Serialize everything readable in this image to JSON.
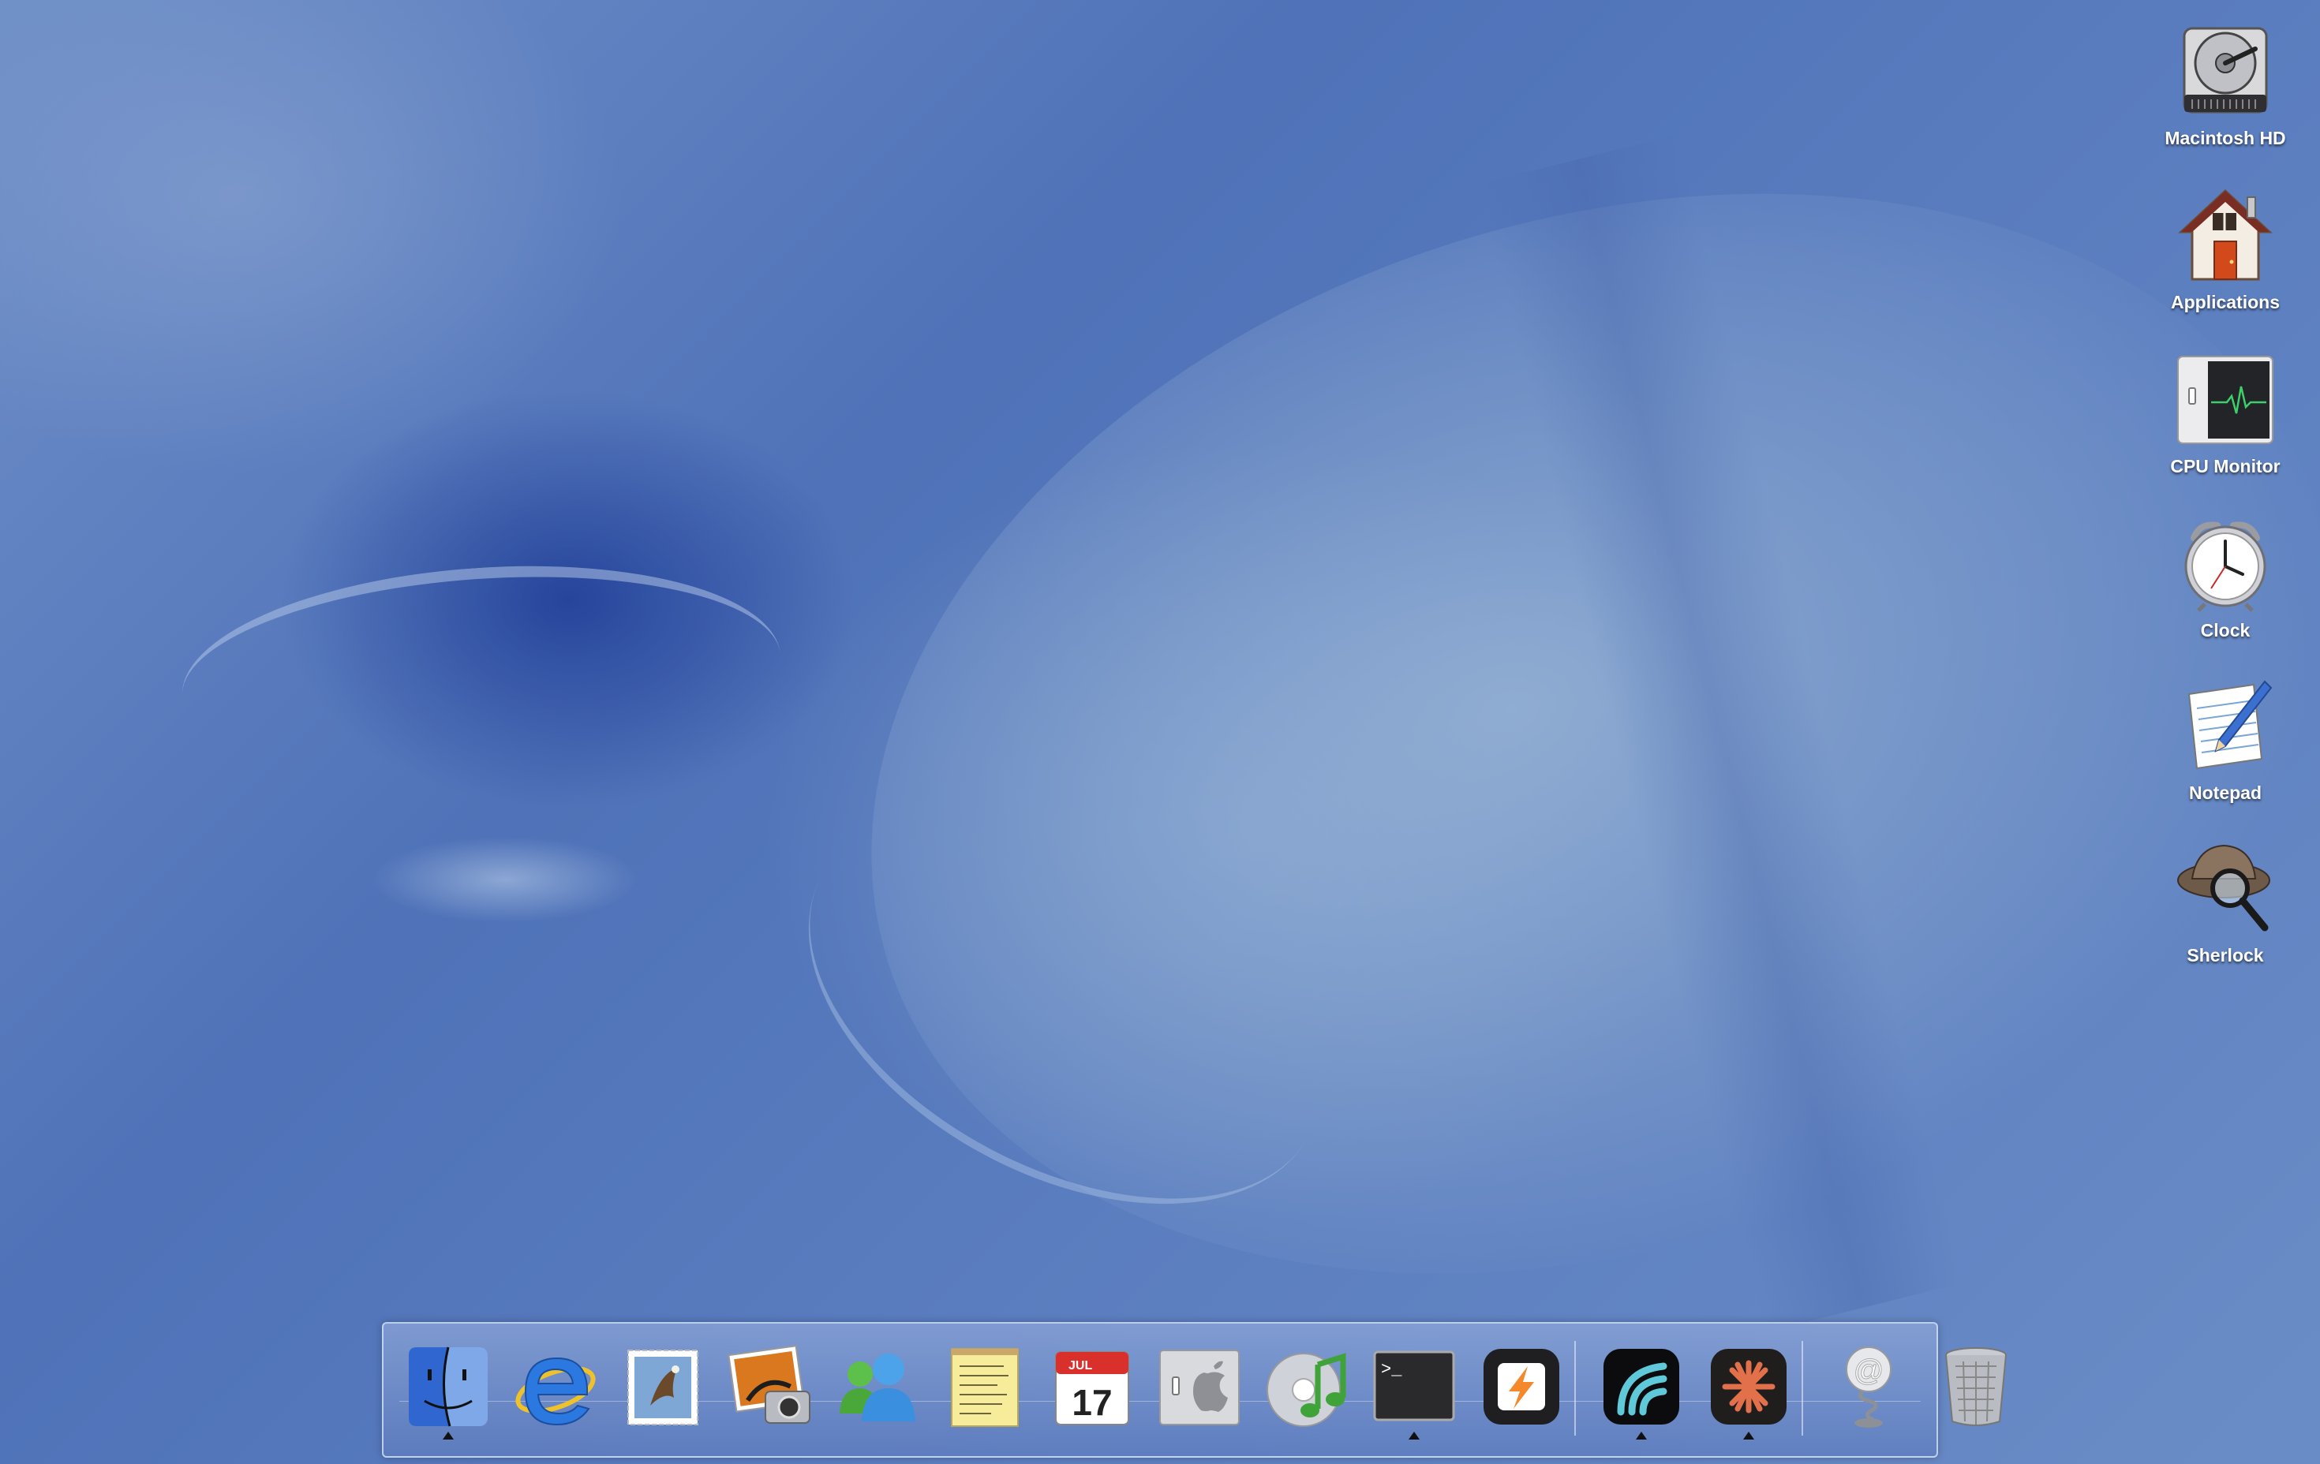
{
  "desktop": {
    "icons": [
      {
        "label": "Macintosh HD",
        "icon": "hard-drive-icon"
      },
      {
        "label": "Applications",
        "icon": "house-icon"
      },
      {
        "label": "CPU Monitor",
        "icon": "cpu-monitor-icon"
      },
      {
        "label": "Clock",
        "icon": "alarm-clock-icon"
      },
      {
        "label": "Notepad",
        "icon": "notepad-pencil-icon"
      },
      {
        "label": "Sherlock",
        "icon": "sherlock-hat-magnifier-icon"
      }
    ]
  },
  "dock": {
    "items": [
      {
        "icon": "finder-icon",
        "running": true
      },
      {
        "icon": "internet-explorer-icon",
        "running": false
      },
      {
        "icon": "mail-stamp-icon",
        "running": false
      },
      {
        "icon": "iphoto-icon",
        "running": false
      },
      {
        "icon": "messenger-icon",
        "running": false
      },
      {
        "icon": "notes-icon",
        "running": false
      },
      {
        "icon": "calendar-icon",
        "running": false,
        "month": "JUL",
        "day": "17"
      },
      {
        "icon": "system-preferences-icon",
        "running": false
      },
      {
        "icon": "itunes-cd-icon",
        "running": false
      },
      {
        "icon": "terminal-icon",
        "running": true,
        "prompt": ">_"
      },
      {
        "icon": "reeder-bolt-icon",
        "running": false
      },
      {
        "icon": "wave-app-icon",
        "running": true
      },
      {
        "icon": "claude-asterisk-icon",
        "running": true
      },
      {
        "icon": "mail-at-icon",
        "running": false
      },
      {
        "icon": "trash-icon",
        "running": false
      }
    ]
  },
  "colors": {
    "desktop_blue": "#4f72b5",
    "label_text": "#ffffff",
    "running_indicator": "#111111"
  }
}
